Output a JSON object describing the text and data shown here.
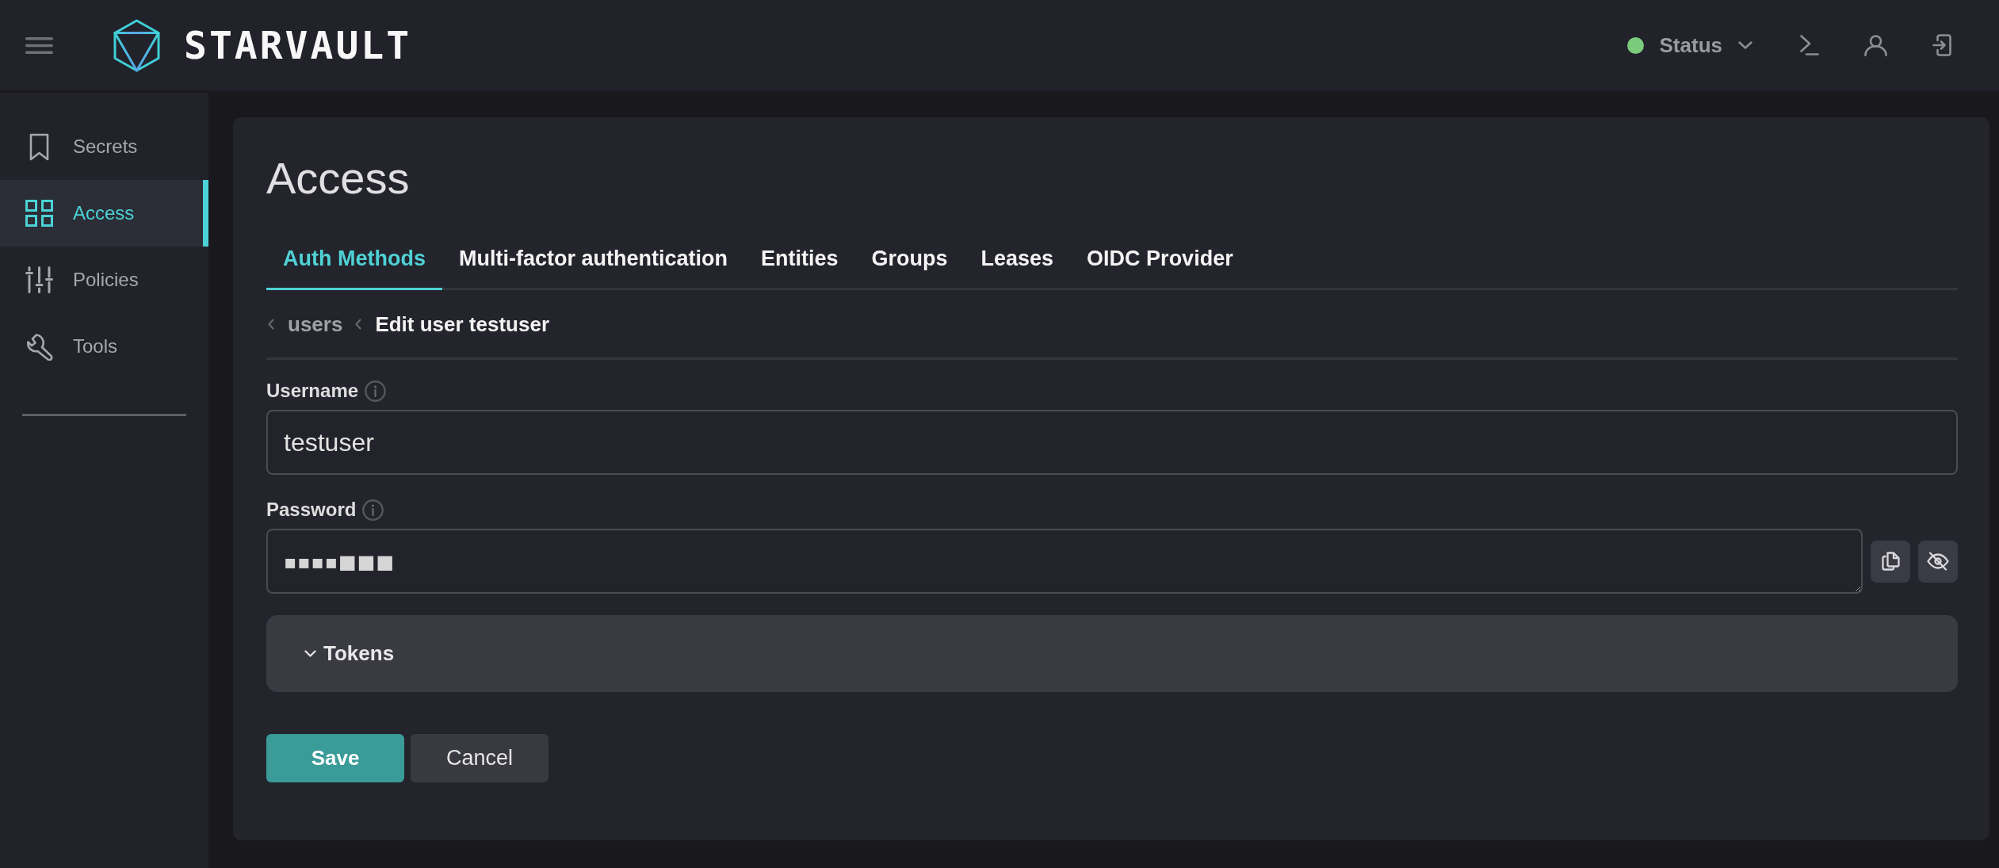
{
  "header": {
    "brand": "STARVAULT",
    "status": {
      "label": "Status",
      "healthy": true
    }
  },
  "sidebar": {
    "items": [
      {
        "label": "Secrets",
        "selected": false
      },
      {
        "label": "Access",
        "selected": true
      },
      {
        "label": "Policies",
        "selected": false
      },
      {
        "label": "Tools",
        "selected": false
      }
    ]
  },
  "page": {
    "title": "Access",
    "tabs": [
      {
        "label": "Auth Methods",
        "selected": true
      },
      {
        "label": "Multi-factor authentication",
        "selected": false
      },
      {
        "label": "Entities",
        "selected": false
      },
      {
        "label": "Groups",
        "selected": false
      },
      {
        "label": "Leases",
        "selected": false
      },
      {
        "label": "OIDC Provider",
        "selected": false
      }
    ],
    "breadcrumb": [
      {
        "label": "users",
        "current": false
      },
      {
        "label": "Edit user testuser",
        "current": true
      }
    ]
  },
  "form": {
    "fields": [
      {
        "kind": "text",
        "label": "Username",
        "value": "testuser"
      },
      {
        "kind": "secret",
        "label": "Password",
        "value": "▪▪▪▪■■■",
        "masked": true
      }
    ],
    "tokens": {
      "label": "Tokens",
      "expanded": false
    },
    "buttons": [
      {
        "kind": "primary",
        "label": "Save"
      },
      {
        "kind": "secondary",
        "label": "Cancel"
      }
    ]
  }
}
